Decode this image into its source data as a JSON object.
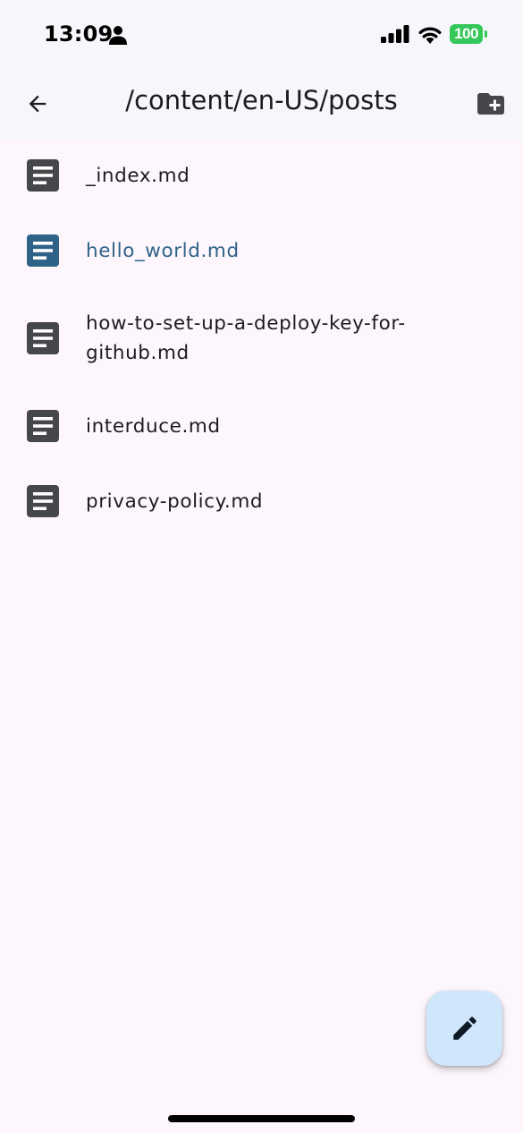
{
  "status_bar": {
    "time": "13:09",
    "battery": "100"
  },
  "app_bar": {
    "title": "/content/en-US/posts"
  },
  "files": [
    {
      "name": "_index.md",
      "selected": false
    },
    {
      "name": "hello_world.md",
      "selected": true
    },
    {
      "name": "how-to-set-up-a-deploy-key-for-github.md",
      "selected": false
    },
    {
      "name": "interduce.md",
      "selected": false
    },
    {
      "name": "privacy-policy.md",
      "selected": false
    }
  ],
  "colors": {
    "background": "#fdf7fd",
    "app_bar": "#f6f7fb",
    "file_icon": "#46474b",
    "selected": "#2e6287",
    "fab": "#cfe6fb",
    "battery": "#34c759"
  },
  "icons": {
    "back": "arrow-back-icon",
    "new_folder": "create-new-folder-icon",
    "file": "description-icon",
    "fab": "edit-pencil-icon"
  }
}
